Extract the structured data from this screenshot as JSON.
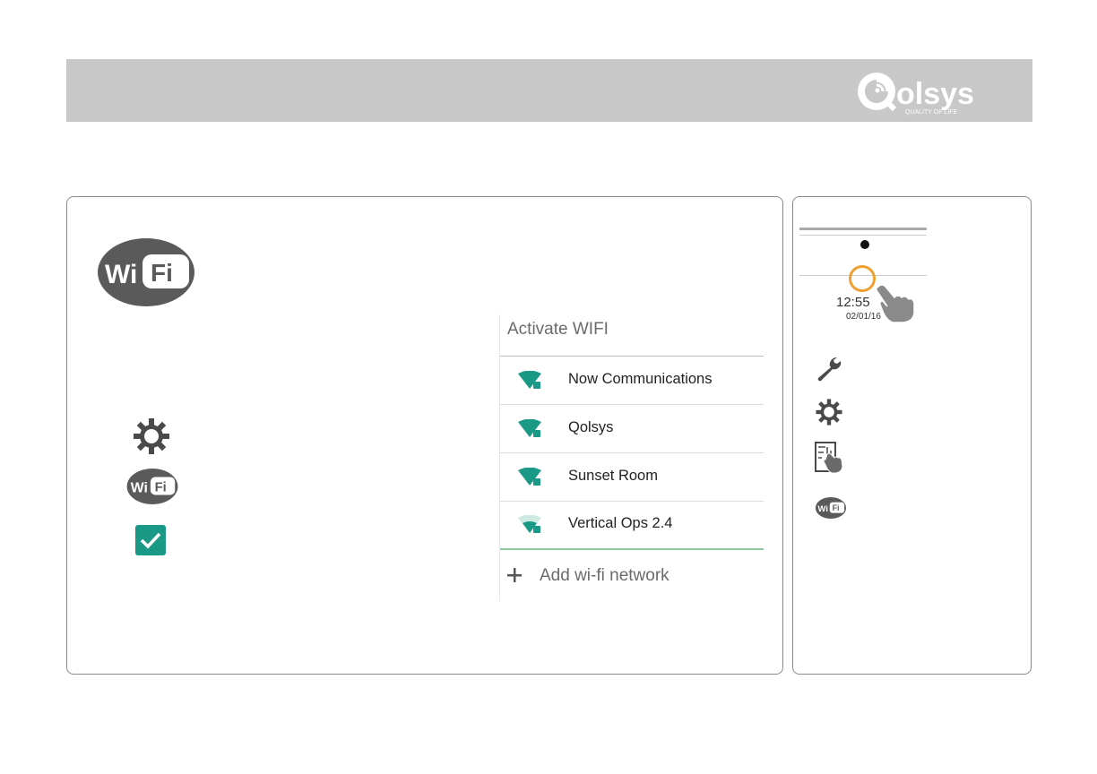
{
  "header": {
    "logo_text": "Qolsys",
    "logo_tagline": "QUALITY OF LIFE"
  },
  "main_panel": {
    "wifi_logo": "Wi Fi",
    "step_icons": [
      "gear-icon",
      "wifi-logo-icon",
      "checkbox-checked-icon"
    ],
    "wifi_screen": {
      "title": "Activate WIFI",
      "networks": [
        {
          "name": "Now Communications",
          "signal": "full"
        },
        {
          "name": "Qolsys",
          "signal": "full"
        },
        {
          "name": "Sunset Room",
          "signal": "full"
        },
        {
          "name": "Vertical Ops 2.4",
          "signal": "weak"
        }
      ],
      "add_label": "Add wi-fi network"
    }
  },
  "side_panel": {
    "time": "12:55",
    "date": "02/01/16",
    "icons": [
      "wrench-icon",
      "gear-icon",
      "touch-panel-icon",
      "wifi-logo-icon"
    ]
  },
  "colors": {
    "header_bg": "#c8c8c8",
    "accent_teal": "#1a9a86",
    "ring_orange": "#f0a030"
  }
}
